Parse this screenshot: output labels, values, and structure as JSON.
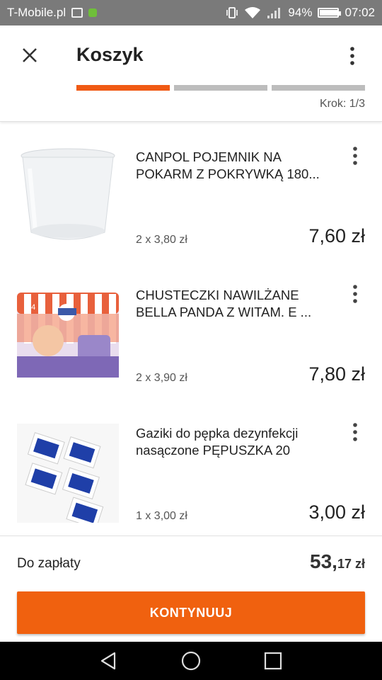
{
  "status_bar": {
    "carrier": "T-Mobile.pl",
    "battery": "94%",
    "battery_level": 0.94,
    "time": "07:02",
    "icons": [
      "image-icon",
      "notification-app-icon",
      "vibrate-icon",
      "wifi-icon",
      "signal-icon",
      "battery-icon"
    ]
  },
  "header": {
    "title": "Koszyk",
    "step_label": "Krok: 1/3",
    "progress_step": 1,
    "progress_total": 3,
    "icons": [
      "close-icon",
      "more-vert-icon"
    ]
  },
  "cart": {
    "items": [
      {
        "name": "CANPOL POJEMNIK NA POKARM Z POKRYWKĄ 180...",
        "quantity_text": "2 x 3,80 zł",
        "total": "7,60 zł",
        "image": "container-image"
      },
      {
        "name": "CHUSTECZKI NAWILŻANE BELLA PANDA Z WITAM. E ...",
        "quantity_text": "2 x 3,90 zł",
        "total": "7,80 zł",
        "image": "wipes-image"
      },
      {
        "name": "Gaziki do pępka dezynfekcji nasączone PĘPUSZKA 20",
        "quantity_text": "1 x 3,00 zł",
        "total": "3,00 zł",
        "image": "gauze-pads-image"
      }
    ]
  },
  "footer": {
    "due_label": "Do zapłaty",
    "due_int": "53,",
    "due_frac": "17 zł",
    "continue_label": "KONTYNUUJ"
  },
  "colors": {
    "accent": "#f0610f",
    "status_bar": "#7a7a7a",
    "progress_inactive": "#bdbdbd"
  }
}
